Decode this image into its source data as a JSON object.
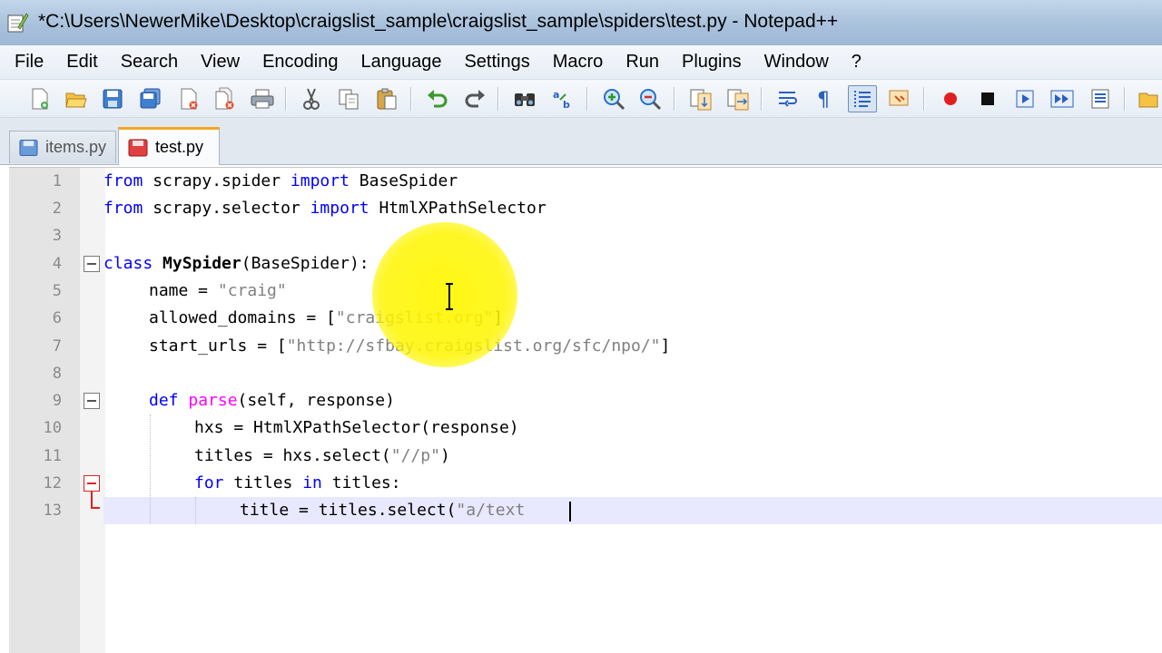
{
  "window": {
    "title": "*C:\\Users\\NewerMike\\Desktop\\craigslist_sample\\craigslist_sample\\spiders\\test.py - Notepad++"
  },
  "menu": {
    "items": [
      "File",
      "Edit",
      "Search",
      "View",
      "Encoding",
      "Language",
      "Settings",
      "Macro",
      "Run",
      "Plugins",
      "Window",
      "?"
    ]
  },
  "toolbar": {
    "buttons": [
      "new-file-icon",
      "open-file-icon",
      "save-icon",
      "save-all-icon",
      "close-icon",
      "close-all-icon",
      "print-icon",
      "cut-icon",
      "copy-icon",
      "paste-icon",
      "undo-icon",
      "redo-icon",
      "find-icon",
      "replace-icon",
      "zoom-in-icon",
      "zoom-out-icon",
      "sync-vertical-icon",
      "sync-horizontal-icon",
      "word-wrap-icon",
      "show-all-chars-icon",
      "indent-guide-icon",
      "language-icon",
      "record-macro-icon",
      "stop-record-icon",
      "play-macro-icon",
      "run-macro-multiple-icon",
      "save-macro-icon",
      "open-folder-icon"
    ]
  },
  "tabs": [
    {
      "label": "items.py",
      "active": false,
      "color": "#6a9ad8"
    },
    {
      "label": "test.py",
      "active": true,
      "color": "#e04040"
    }
  ],
  "editor": {
    "line_numbers": [
      "1",
      "2",
      "3",
      "4",
      "5",
      "6",
      "7",
      "8",
      "9",
      "10",
      "11",
      "12",
      "13"
    ],
    "lines": {
      "l1": {
        "kw1": "from",
        "t1": " scrapy.spider ",
        "kw2": "import",
        "t2": " BaseSpider"
      },
      "l2": {
        "kw1": "from",
        "t1": " scrapy.selector ",
        "kw2": "import",
        "t2": " HtmlXPathSelector"
      },
      "l4": {
        "kw": "class",
        "name": " MySpider",
        "rest": "(BaseSpider):"
      },
      "l5": {
        "a": "name = ",
        "s": "\"craig\""
      },
      "l6": {
        "a": "allowed_domains = [",
        "s": "\"craigslist.org\"",
        "b": "]"
      },
      "l7": {
        "a": "start_urls = [",
        "s": "\"http://sfbay.craigslist.org/sfc/npo/\"",
        "b": "]"
      },
      "l9": {
        "kw": "def",
        "fn": " parse",
        "rest": "(self, response)"
      },
      "l10": {
        "a": "hxs = HtmlXPathSelector(response)"
      },
      "l11": {
        "a": "titles = hxs.select(",
        "s": "\"//p\"",
        "b": ")"
      },
      "l12": {
        "kw1": "for",
        "t1": " titles ",
        "kw2": "in",
        "t2": " titles:"
      },
      "l13": {
        "a": "title = titles.select(",
        "s": "\"a/text"
      }
    }
  },
  "colors": {
    "keyword": "#0000ff",
    "function": "#ff00ff",
    "string": "#808080",
    "cursor_highlight": "#fff500",
    "active_tab_accent": "#f5a623"
  }
}
